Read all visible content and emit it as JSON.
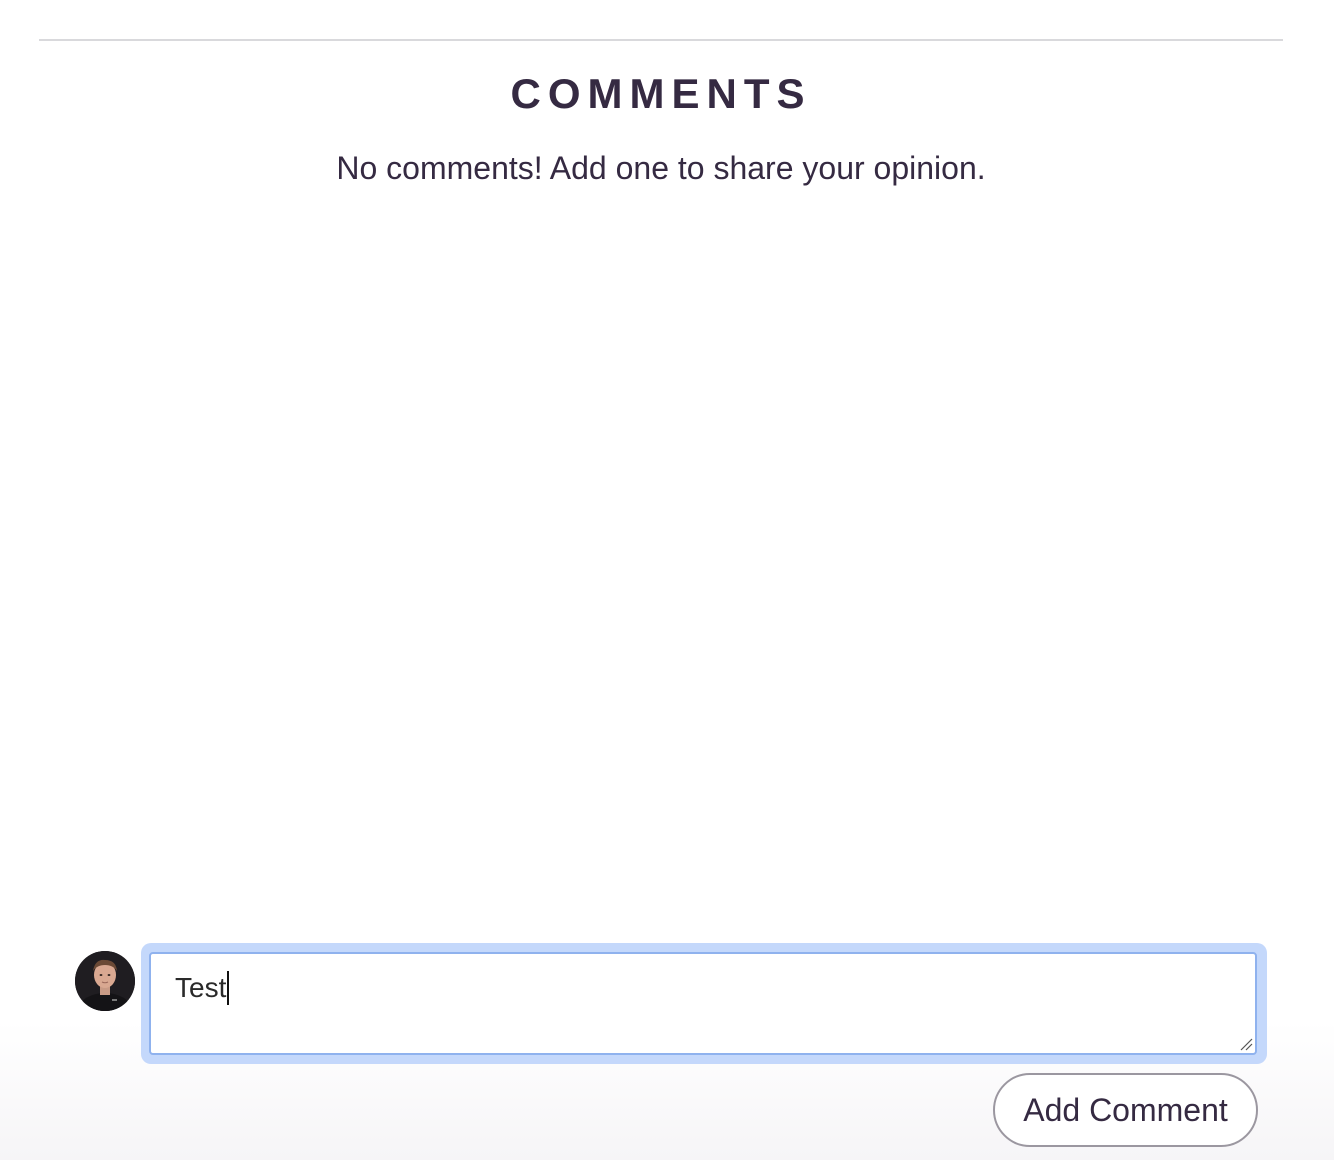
{
  "comments_section": {
    "title": "COMMENTS",
    "empty_message": "No comments! Add one to share your opinion."
  },
  "composer": {
    "avatar_icon": "user-avatar",
    "input_value": "Test",
    "submit_label": "Add Comment"
  },
  "colors": {
    "text": "#352a42",
    "focus_ring": "#c4d8fb",
    "input_border": "#8fb2ee",
    "divider": "#d9d9dc",
    "button_border": "#9b97a0"
  }
}
